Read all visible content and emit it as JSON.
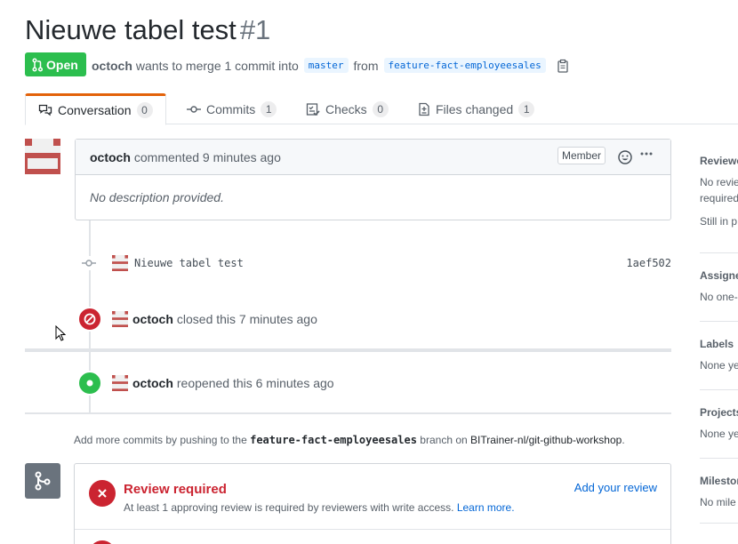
{
  "pr": {
    "title": "Nieuwe tabel test",
    "number": "#1",
    "state": "Open",
    "author": "octoch",
    "merge_text": "wants to merge 1 commit into",
    "base_branch": "master",
    "from_text": "from",
    "head_branch": "feature-fact-employeesales"
  },
  "tabs": [
    {
      "label": "Conversation",
      "count": "0",
      "icon": "comment-discussion-icon"
    },
    {
      "label": "Commits",
      "count": "1",
      "icon": "git-commit-icon"
    },
    {
      "label": "Checks",
      "count": "0",
      "icon": "checklist-icon"
    },
    {
      "label": "Files changed",
      "count": "1",
      "icon": "diff-icon"
    }
  ],
  "comment": {
    "author": "octoch",
    "action": "commented 9 minutes ago",
    "badge": "Member",
    "body": "No description provided."
  },
  "commit": {
    "message": "Nieuwe tabel test",
    "sha": "1aef502"
  },
  "events": {
    "closed": {
      "author": "octoch",
      "text": "closed this 7 minutes ago"
    },
    "reopened": {
      "author": "octoch",
      "text": "reopened this 6 minutes ago"
    }
  },
  "push_hint": {
    "prefix": "Add more commits by pushing to the",
    "branch": "feature-fact-employeesales",
    "middle": "branch on",
    "repo": "BITrainer-nl/git-github-workshop",
    "suffix": "."
  },
  "merge": {
    "review_title": "Review required",
    "review_desc": "At least 1 approving review is required by reviewers with write access.",
    "learn_more": "Learn more.",
    "add_review": "Add your review"
  },
  "sidebar": {
    "reviewers": {
      "head": "Reviewe",
      "line1": "No revie",
      "line2": "required",
      "line3": "Still in p"
    },
    "assignees": {
      "head": "Assigne",
      "line1": "No one-"
    },
    "labels": {
      "head": "Labels",
      "line1": "None ye"
    },
    "projects": {
      "head": "Projects",
      "line1": "None ye"
    },
    "milestone": {
      "head": "Milestor",
      "line1": "No mile"
    }
  },
  "colors": {
    "open_green": "#2cbe4e",
    "closed_red": "#cb2431",
    "link_blue": "#0366d6",
    "tab_accent": "#e36209"
  }
}
